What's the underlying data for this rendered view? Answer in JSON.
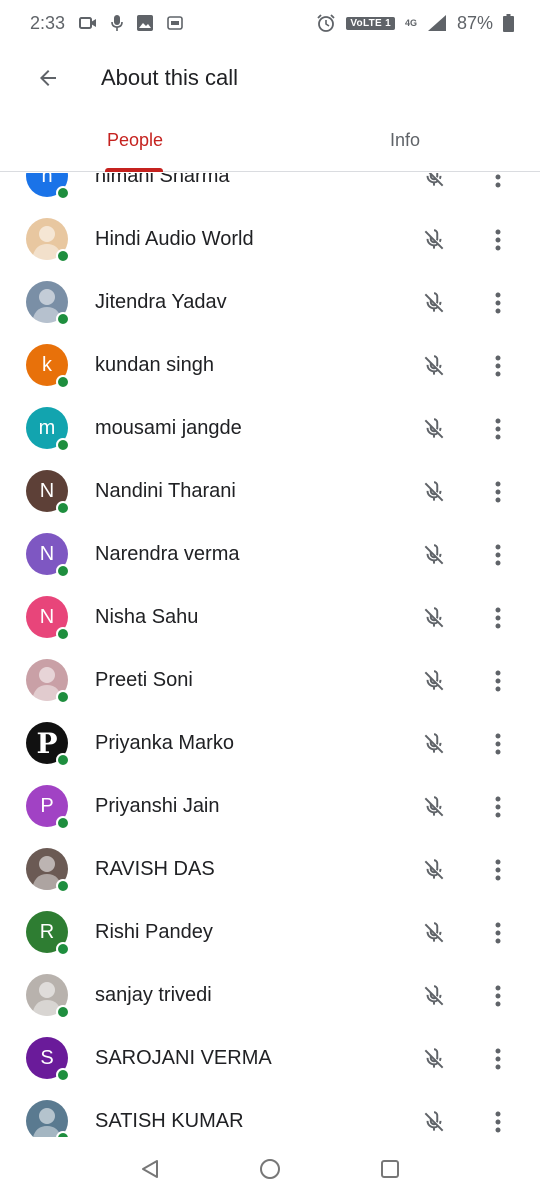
{
  "status_bar": {
    "time": "2:33",
    "network": "VoLTE 1",
    "network_type": "4G",
    "battery": "87%"
  },
  "header": {
    "title": "About this call"
  },
  "tabs": [
    {
      "label": "People",
      "active": true
    },
    {
      "label": "Info",
      "active": false
    }
  ],
  "participants": [
    {
      "name": "himani Sharma",
      "initial": "h",
      "color": "#1a73e8",
      "photo": false
    },
    {
      "name": "Hindi Audio World",
      "initial": "",
      "color": "#e8c7a0",
      "photo": true
    },
    {
      "name": "Jitendra Yadav",
      "initial": "",
      "color": "#7a8fa6",
      "photo": true
    },
    {
      "name": "kundan singh",
      "initial": "k",
      "color": "#e8710a",
      "photo": false
    },
    {
      "name": "mousami jangde",
      "initial": "m",
      "color": "#12a4af",
      "photo": false
    },
    {
      "name": "Nandini Tharani",
      "initial": "N",
      "color": "#5d4037",
      "photo": false
    },
    {
      "name": "Narendra verma",
      "initial": "N",
      "color": "#7e57c2",
      "photo": false
    },
    {
      "name": "Nisha Sahu",
      "initial": "N",
      "color": "#e8457a",
      "photo": false
    },
    {
      "name": "Preeti Soni",
      "initial": "",
      "color": "#c9a0a6",
      "photo": true
    },
    {
      "name": "Priyanka Marko",
      "initial": "P",
      "color": "#111111",
      "photo": true
    },
    {
      "name": "Priyanshi Jain",
      "initial": "P",
      "color": "#a142c4",
      "photo": false
    },
    {
      "name": "RAVISH DAS",
      "initial": "",
      "color": "#6b5a54",
      "photo": true
    },
    {
      "name": "Rishi Pandey",
      "initial": "R",
      "color": "#2e7d32",
      "photo": false
    },
    {
      "name": "sanjay trivedi",
      "initial": "",
      "color": "#b8b2ad",
      "photo": true
    },
    {
      "name": "SAROJANI VERMA",
      "initial": "S",
      "color": "#6a1b9a",
      "photo": false
    },
    {
      "name": "SATISH KUMAR",
      "initial": "",
      "color": "#5a7a90",
      "photo": true
    }
  ],
  "colors": {
    "accent": "#c5221f",
    "online": "#1e8e3e",
    "icon": "#5f6368"
  }
}
